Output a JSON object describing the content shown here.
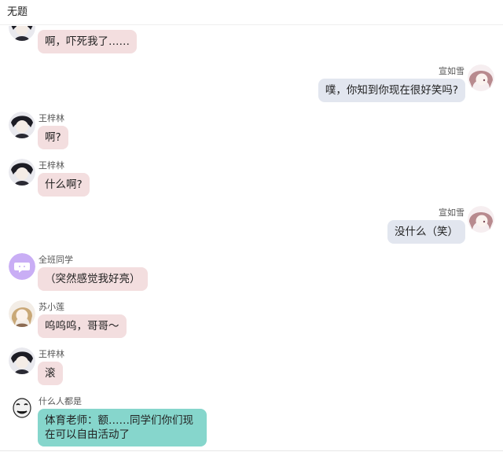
{
  "window": {
    "title": "无题"
  },
  "messages": [
    {
      "sender": "",
      "text": "啊，吓死我了……",
      "side": "left",
      "avatar": "boy-dark-hair-avatar"
    },
    {
      "sender": "宣如雪",
      "text": "噗，你知到你现在很好笑吗?",
      "side": "right",
      "avatar": "girl-pink-hair-avatar"
    },
    {
      "sender": "王梓林",
      "text": "啊?",
      "side": "left",
      "avatar": "boy-dark-hair-avatar"
    },
    {
      "sender": "王梓林",
      "text": "什么啊?",
      "side": "left",
      "avatar": "boy-dark-hair-avatar"
    },
    {
      "sender": "宣如雪",
      "text": "没什么（笑）",
      "side": "right",
      "avatar": "girl-pink-hair-avatar"
    },
    {
      "sender": "全班同学",
      "text": "（突然感觉我好亮）",
      "side": "left",
      "avatar": "purple-chat-bubble-avatar"
    },
    {
      "sender": "苏小莲",
      "text": "呜呜呜，哥哥～",
      "side": "left",
      "avatar": "girl-blonde-avatar"
    },
    {
      "sender": "王梓林",
      "text": "滚",
      "side": "left",
      "avatar": "boy-dark-hair-avatar"
    },
    {
      "sender": "什么人都是",
      "text": "体育老师：额……同学们你们现在可以自由活动了",
      "side": "left",
      "avatar": "meme-face-avatar"
    }
  ],
  "colors": {
    "left_bubble": "#f3dedf",
    "right_bubble": "#e2e6ef",
    "teacher_bubble": "#86d6cc",
    "purple_avatar": "#c9aef5"
  }
}
